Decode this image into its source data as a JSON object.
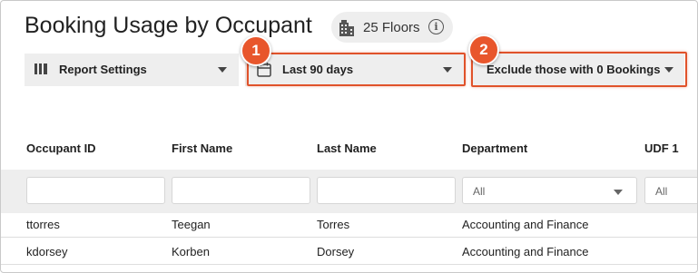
{
  "header": {
    "title": "Booking Usage by Occupant",
    "floors_label": "25 Floors",
    "info_icon": "info-icon"
  },
  "controls": {
    "report_settings_label": "Report Settings",
    "date_range_label": "Last 90 days",
    "exclude_label": "Exclude those with 0 Bookings"
  },
  "callouts": [
    "1",
    "2"
  ],
  "table": {
    "columns": [
      "Occupant ID",
      "First Name",
      "Last Name",
      "Department",
      "UDF 1"
    ],
    "filters": {
      "department_placeholder": "All",
      "udf1_placeholder": "All"
    },
    "rows": [
      [
        "ttorres",
        "Teegan",
        "Torres",
        "Accounting and Finance"
      ],
      [
        "kdorsey",
        "Korben",
        "Dorsey",
        "Accounting and Finance"
      ]
    ]
  },
  "colors": {
    "accent": "#e8562c",
    "panel_bg": "#eeeeee"
  }
}
